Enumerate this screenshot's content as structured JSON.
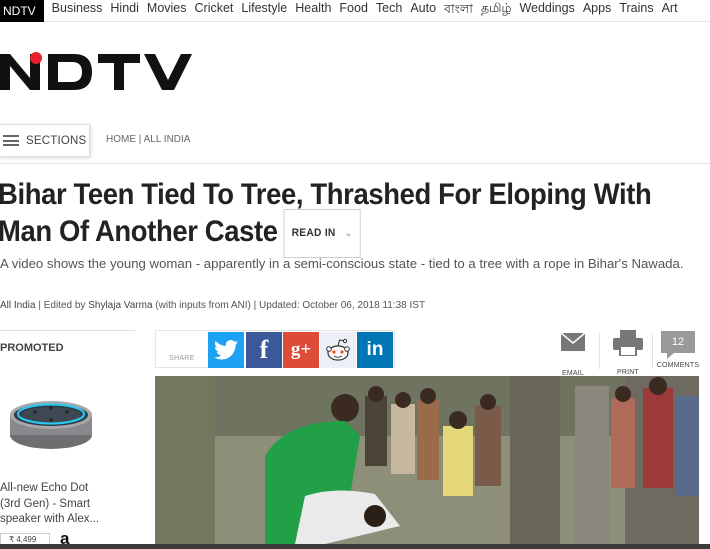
{
  "topnav": {
    "brand": "NDTV",
    "items": [
      "Business",
      "Hindi",
      "Movies",
      "Cricket",
      "Lifestyle",
      "Health",
      "Food",
      "Tech",
      "Auto",
      "বাংলা",
      "தமிழ்",
      "Weddings",
      "Apps",
      "Trains",
      "Art"
    ]
  },
  "logo": {
    "text": "NDTV",
    "colors": {
      "letters": "#111111",
      "dot": "#e5202e"
    }
  },
  "sections": {
    "label": "SECTIONS",
    "icon": "hamburger-icon"
  },
  "breadcrumb": "HOME | ALL INDIA",
  "article": {
    "headline": "Bihar Teen Tied To Tree, Thrashed For Eloping With Man Of Another Caste",
    "read_in": "READ IN",
    "summary": "A video shows the young woman - apparently in a semi-conscious state - tied to a tree with a rope in Bihar's Nawada.",
    "byline": {
      "category": "All India",
      "edited_prefix": " | Edited by ",
      "editor": "Shylaja Varma",
      "rest": " (with inputs from ANI) | Updated: October 06, 2018 11:38 IST"
    }
  },
  "promoted": {
    "label": "PROMOTED",
    "product": "All-new Echo Dot (3rd Gen) - Smart speaker with Alex...",
    "price": "₹ 4,499",
    "store_logo": "a"
  },
  "share": {
    "label": "SHARE",
    "buttons": [
      {
        "name": "twitter",
        "icon": "twitter-icon",
        "color": "#1da1f2"
      },
      {
        "name": "facebook",
        "icon": "facebook-icon",
        "color": "#3b5998",
        "glyph": "f"
      },
      {
        "name": "google-plus",
        "icon": "google-plus-icon",
        "color": "#dd4b39",
        "glyph": "g+"
      },
      {
        "name": "reddit",
        "icon": "reddit-icon",
        "color": "#eceff5"
      },
      {
        "name": "linkedin",
        "icon": "linkedin-icon",
        "color": "#0077b5",
        "glyph": "in"
      }
    ]
  },
  "tools": {
    "email": "EMAIL",
    "print": "PRINT",
    "comments": "COMMENTS",
    "comment_count": "12"
  }
}
